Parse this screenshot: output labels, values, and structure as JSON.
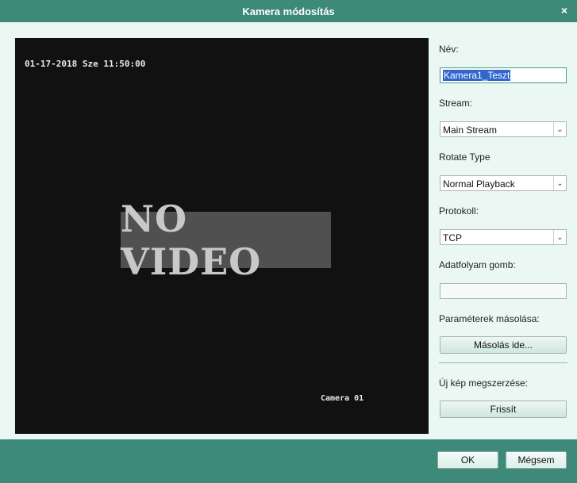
{
  "dialog": {
    "title": "Kamera módosítás",
    "close_glyph": "×"
  },
  "video": {
    "osd_datetime": "01-17-2018 Sze 11:50:00",
    "osd_camera": "Camera 01",
    "no_video_text": "NO VIDEO"
  },
  "form": {
    "name_label": "Név:",
    "name_value": "Kamera1_Teszt",
    "stream_label": "Stream:",
    "stream_value": "Main Stream",
    "rotate_label": "Rotate Type",
    "rotate_value": "Normal Playback",
    "protocol_label": "Protokoll:",
    "protocol_value": "TCP",
    "streambutton_label": "Adatfolyam gomb:",
    "streambutton_value": "",
    "copy_label": "Paraméterek másolása:",
    "copy_button": "Másolás ide...",
    "newimage_label": "Új kép megszerzése:",
    "refresh_button": "Frissít"
  },
  "footer": {
    "ok": "OK",
    "cancel": "Mégsem"
  },
  "icons": {
    "dropdown": "chevron-down-icon",
    "close": "close-icon"
  },
  "colors": {
    "titlebar": "#3e8a79",
    "background": "#eaf7f3",
    "selection": "#3366cc"
  }
}
